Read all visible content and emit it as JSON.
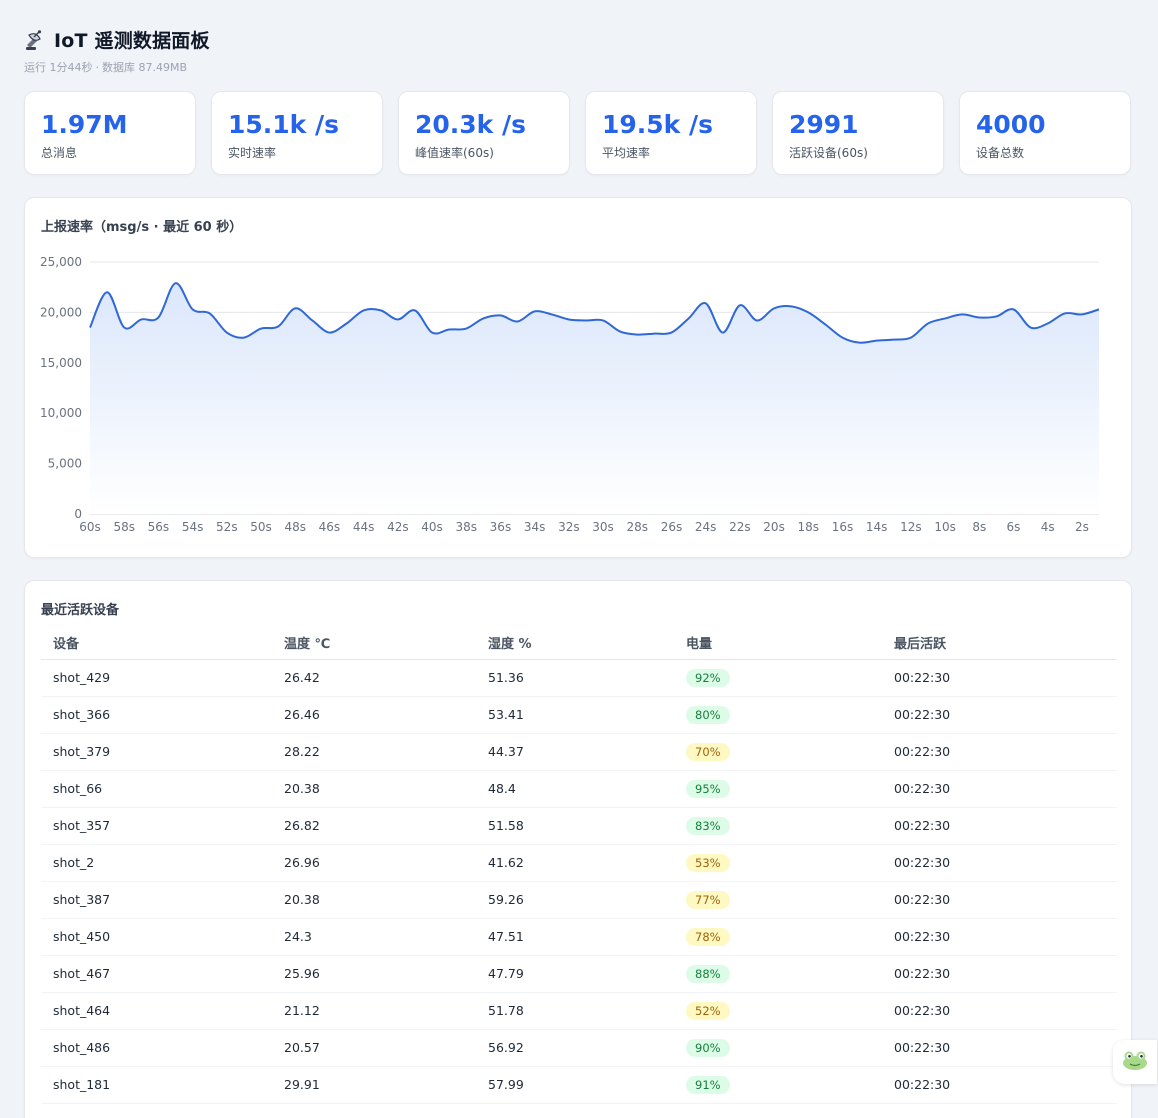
{
  "header": {
    "title": "IoT 遥测数据面板",
    "uptime": "运行 1分44秒",
    "separator": "·",
    "db_size": "数据库 87.49MB"
  },
  "stats": [
    {
      "value": "1.97M",
      "label": "总消息"
    },
    {
      "value": "15.1k /s",
      "label": "实时速率"
    },
    {
      "value": "20.3k /s",
      "label": "峰值速率(60s)"
    },
    {
      "value": "19.5k /s",
      "label": "平均速率"
    },
    {
      "value": "2991",
      "label": "活跃设备(60s)"
    },
    {
      "value": "4000",
      "label": "设备总数"
    }
  ],
  "chart_data": {
    "type": "area",
    "title": "上报速率（msg/s · 最近 60 秒）",
    "xlabel": "",
    "ylabel": "",
    "ylim": [
      0,
      25000
    ],
    "y_ticks": [
      "0",
      "5,000",
      "10,000",
      "15,000",
      "20,000",
      "25,000"
    ],
    "x_ticks": [
      "60s",
      "58s",
      "56s",
      "54s",
      "52s",
      "50s",
      "48s",
      "46s",
      "44s",
      "42s",
      "40s",
      "38s",
      "36s",
      "34s",
      "32s",
      "30s",
      "28s",
      "26s",
      "24s",
      "22s",
      "20s",
      "18s",
      "16s",
      "14s",
      "12s",
      "10s",
      "8s",
      "6s",
      "4s",
      "2s"
    ],
    "x": [
      60,
      59,
      58,
      57,
      56,
      55,
      54,
      53,
      52,
      51,
      50,
      49,
      48,
      47,
      46,
      45,
      44,
      43,
      42,
      41,
      40,
      39,
      38,
      37,
      36,
      35,
      34,
      33,
      32,
      31,
      30,
      29,
      28,
      27,
      26,
      25,
      24,
      23,
      22,
      21,
      20,
      19,
      18,
      17,
      16,
      15,
      14,
      13,
      12,
      11,
      10,
      9,
      8,
      7,
      6,
      5,
      4,
      3,
      2,
      1
    ],
    "values": [
      18500,
      22000,
      18500,
      19300,
      19500,
      22900,
      20300,
      19900,
      18000,
      17500,
      18400,
      18600,
      20400,
      19200,
      18000,
      18900,
      20200,
      20200,
      19300,
      20200,
      18000,
      18300,
      18400,
      19400,
      19700,
      19100,
      20100,
      19800,
      19300,
      19200,
      19200,
      18100,
      17800,
      17900,
      18000,
      19400,
      20900,
      18000,
      20700,
      19200,
      20400,
      20600,
      20000,
      18800,
      17500,
      17000,
      17200,
      17300,
      17500,
      18900,
      19400,
      19800,
      19500,
      19600,
      20300,
      18500,
      18900,
      19900,
      19800,
      20300
    ],
    "grid": true,
    "legend": "none",
    "line_color": "#2f68d6",
    "fill_color": "#dbe7fb"
  },
  "table": {
    "title": "最近活跃设备",
    "headers": [
      "设备",
      "温度 ℃",
      "湿度 %",
      "电量",
      "最后活跃"
    ],
    "rows": [
      {
        "device": "shot_429",
        "temp": "26.42",
        "humidity": "51.36",
        "battery": "92%",
        "level": "high",
        "last": "00:22:30"
      },
      {
        "device": "shot_366",
        "temp": "26.46",
        "humidity": "53.41",
        "battery": "80%",
        "level": "high",
        "last": "00:22:30"
      },
      {
        "device": "shot_379",
        "temp": "28.22",
        "humidity": "44.37",
        "battery": "70%",
        "level": "mid",
        "last": "00:22:30"
      },
      {
        "device": "shot_66",
        "temp": "20.38",
        "humidity": "48.4",
        "battery": "95%",
        "level": "high",
        "last": "00:22:30"
      },
      {
        "device": "shot_357",
        "temp": "26.82",
        "humidity": "51.58",
        "battery": "83%",
        "level": "high",
        "last": "00:22:30"
      },
      {
        "device": "shot_2",
        "temp": "26.96",
        "humidity": "41.62",
        "battery": "53%",
        "level": "mid",
        "last": "00:22:30"
      },
      {
        "device": "shot_387",
        "temp": "20.38",
        "humidity": "59.26",
        "battery": "77%",
        "level": "mid",
        "last": "00:22:30"
      },
      {
        "device": "shot_450",
        "temp": "24.3",
        "humidity": "47.51",
        "battery": "78%",
        "level": "mid",
        "last": "00:22:30"
      },
      {
        "device": "shot_467",
        "temp": "25.96",
        "humidity": "47.79",
        "battery": "88%",
        "level": "high",
        "last": "00:22:30"
      },
      {
        "device": "shot_464",
        "temp": "21.12",
        "humidity": "51.78",
        "battery": "52%",
        "level": "mid",
        "last": "00:22:30"
      },
      {
        "device": "shot_486",
        "temp": "20.57",
        "humidity": "56.92",
        "battery": "90%",
        "level": "high",
        "last": "00:22:30"
      },
      {
        "device": "shot_181",
        "temp": "29.91",
        "humidity": "57.99",
        "battery": "91%",
        "level": "high",
        "last": "00:22:30"
      }
    ]
  },
  "icons": {
    "title_icon": "satellite-dish-icon",
    "floating_button": "frog-icon"
  }
}
